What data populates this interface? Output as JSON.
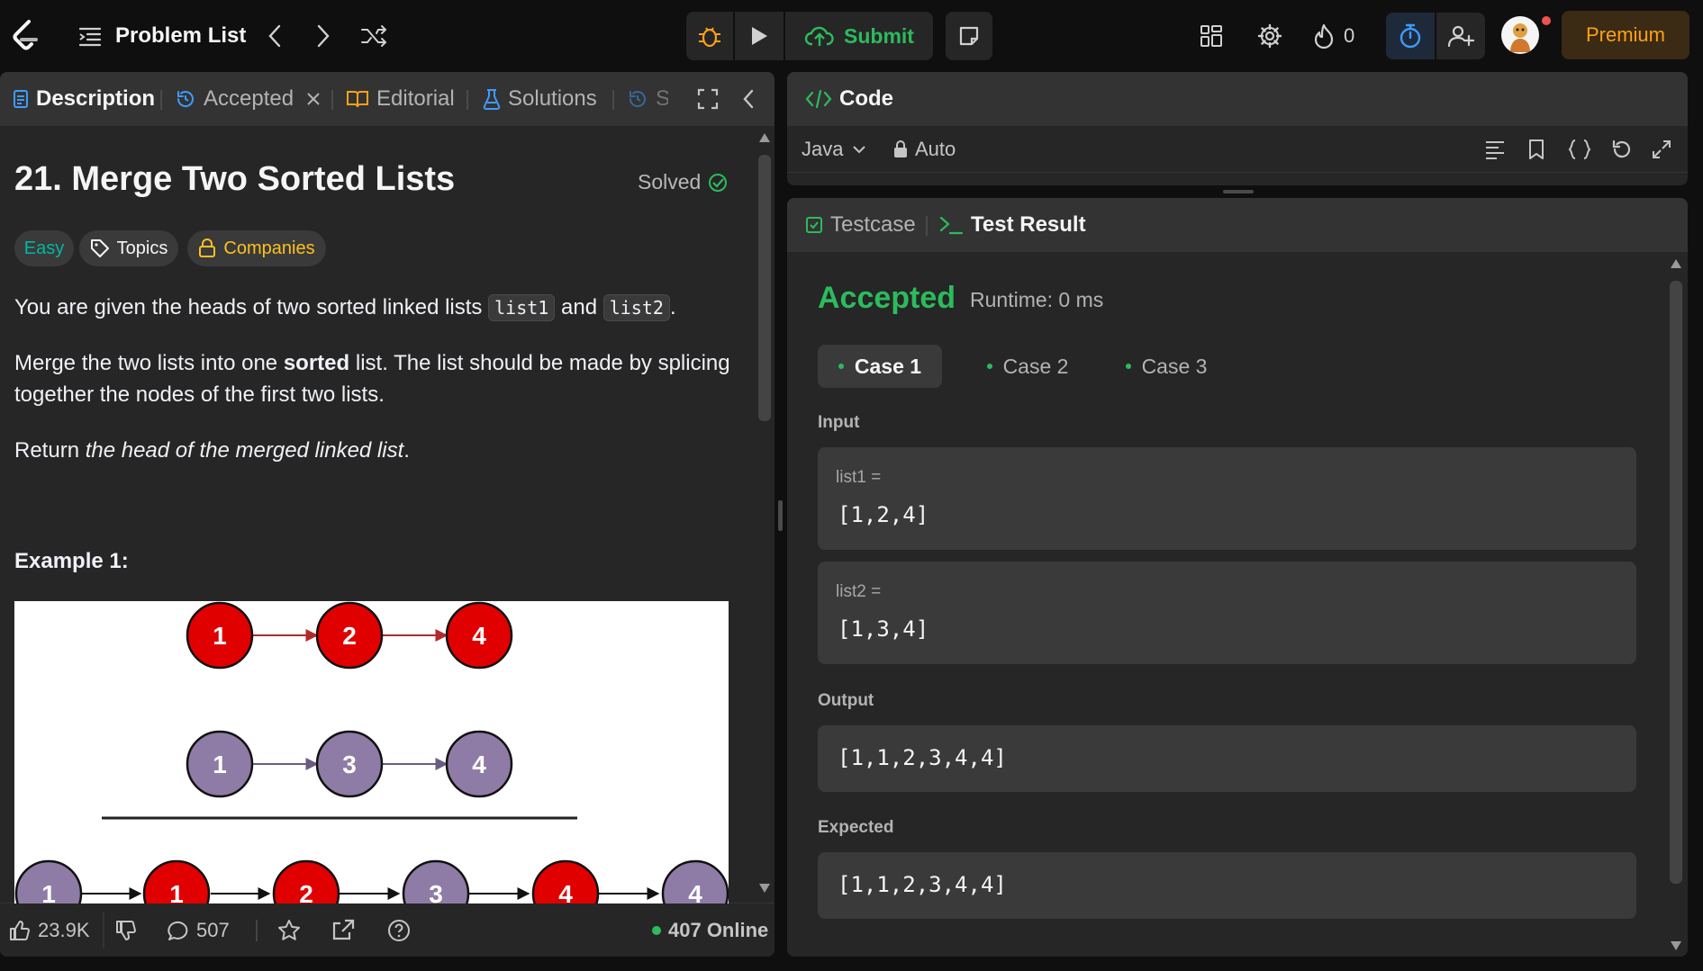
{
  "nav": {
    "title": "Problem List",
    "submit_label": "Submit",
    "streak": "0",
    "premium": "Premium"
  },
  "desc_tabs": [
    {
      "label": "Description"
    },
    {
      "label": "Accepted"
    },
    {
      "label": "Editorial"
    },
    {
      "label": "Solutions"
    },
    {
      "label": "S"
    }
  ],
  "problem": {
    "title": "21. Merge Two Sorted Lists",
    "status": "Solved",
    "difficulty": "Easy",
    "topics": "Topics",
    "companies": "Companies",
    "p1_a": "You are given the heads of two sorted linked lists ",
    "p1_code1": "list1",
    "p1_b": " and ",
    "p1_code2": "list2",
    "p1_c": ".",
    "p2_a": "Merge the two lists into one ",
    "p2_bold": "sorted",
    "p2_b": " list. The list should be made by splicing together the nodes of the first two lists.",
    "p3_a": "Return ",
    "p3_italic": "the head of the merged linked list",
    "p3_b": ".",
    "example_title": "Example 1:",
    "example_lists": {
      "row1": [
        "1",
        "2",
        "4"
      ],
      "row2": [
        "1",
        "3",
        "4"
      ],
      "row3": [
        "1",
        "1",
        "2",
        "3",
        "4",
        "4"
      ]
    }
  },
  "bottom": {
    "likes": "23.9K",
    "comments": "507",
    "online": "407 Online"
  },
  "code": {
    "title": "Code",
    "language": "Java",
    "mode": "Auto"
  },
  "result": {
    "tab_testcase": "Testcase",
    "tab_result": "Test Result",
    "status": "Accepted",
    "runtime": "Runtime: 0 ms",
    "cases": [
      "Case 1",
      "Case 2",
      "Case 3"
    ],
    "input_label": "Input",
    "var1_name": "list1 =",
    "var1_value": "[1,2,4]",
    "var2_name": "list2 =",
    "var2_value": "[1,3,4]",
    "output_label": "Output",
    "output_value": "[1,1,2,3,4,4]",
    "expected_label": "Expected",
    "expected_value": "[1,1,2,3,4,4]"
  },
  "colors": {
    "accent_green": "#2cbb5d",
    "easy": "#00b8a3",
    "companies": "#ffc01e",
    "premium": "#ffa116",
    "node_red": "#e00000",
    "node_purple": "#8e7ca6"
  }
}
